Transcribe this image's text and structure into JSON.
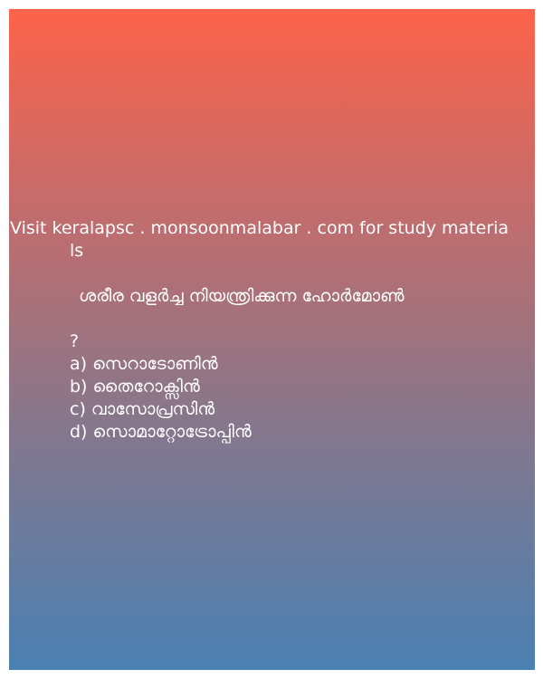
{
  "header": {
    "promo_line1": "Visit keralapsc . monsoonmalabar . com for study materia",
    "promo_line2": "ls"
  },
  "question": {
    "text": "ശരീര വളർച്ച നിയന്ത്രിക്കുന്ന ഹോർമോൺ",
    "mark": "?"
  },
  "options": [
    "a) സെറാടോണിൻ",
    "b) തൈറോക്സിൻ",
    "c) വാസോപ്രസിൻ",
    "d) സൊമാറ്റോട്രോപ്പിൻ"
  ],
  "colors": {
    "gradient_top": "#fd634a",
    "gradient_bottom": "#4a80b2",
    "text": "#ffffff"
  }
}
